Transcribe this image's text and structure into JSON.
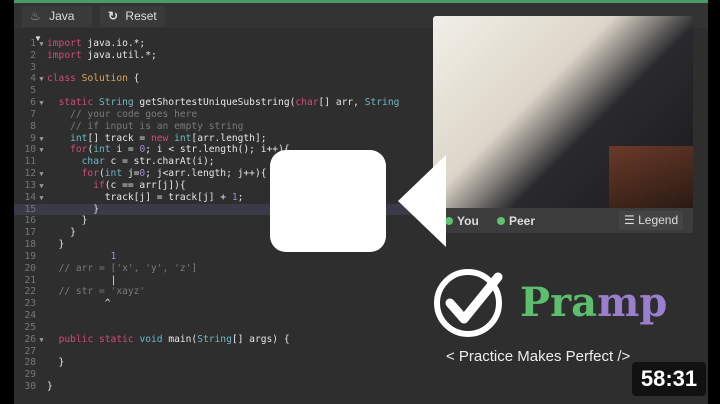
{
  "toolbar": {
    "language": "Java",
    "reset": "Reset"
  },
  "code": [
    {
      "n": "1",
      "f": true,
      "t": [
        [
          "import",
          "kw"
        ],
        " java.io.*;"
      ]
    },
    {
      "n": "2",
      "t": [
        [
          "import",
          "kw"
        ],
        " java.util.*;"
      ]
    },
    {
      "n": "3",
      "t": []
    },
    {
      "n": "4",
      "f": true,
      "t": [
        [
          "class",
          "kw"
        ],
        " ",
        [
          "Solution",
          "cl"
        ],
        " {"
      ]
    },
    {
      "n": "5",
      "t": []
    },
    {
      "n": "6",
      "f": true,
      "t": [
        "  ",
        [
          "static",
          "kw"
        ],
        " ",
        [
          "String",
          "ty"
        ],
        " getShortestUniqueSubstring(",
        [
          "char",
          "kw"
        ],
        "[] arr, ",
        [
          "String",
          "ty"
        ]
      ]
    },
    {
      "n": "7",
      "t": [
        "    ",
        [
          "// your code goes here",
          "cm"
        ]
      ]
    },
    {
      "n": "8",
      "t": [
        "    ",
        [
          "// if input is an empty string",
          "cm"
        ]
      ]
    },
    {
      "n": "9",
      "f": true,
      "t": [
        "    ",
        [
          "int",
          "ty"
        ],
        "[] track = ",
        [
          "new",
          "kw"
        ],
        " ",
        [
          "int",
          "ty"
        ],
        "[arr.length];"
      ]
    },
    {
      "n": "10",
      "f": true,
      "t": [
        "    ",
        [
          "for",
          "kw"
        ],
        "(",
        [
          "int",
          "ty"
        ],
        " i = ",
        [
          "0",
          "nu"
        ],
        "; i < str.length(); i++){"
      ]
    },
    {
      "n": "11",
      "t": [
        "      ",
        [
          "char",
          "ty"
        ],
        " c = str.charAt(i);"
      ]
    },
    {
      "n": "12",
      "f": true,
      "t": [
        "      ",
        [
          "for",
          "kw"
        ],
        "(",
        [
          "int",
          "ty"
        ],
        " j=",
        [
          "0",
          "nu"
        ],
        "; j<arr.length; j++){"
      ]
    },
    {
      "n": "13",
      "f": true,
      "t": [
        "        ",
        [
          "if",
          "kw"
        ],
        "(c == arr[j]){"
      ]
    },
    {
      "n": "14",
      "f": true,
      "t": [
        "          track[j] = track[j] + ",
        [
          "1",
          "nu"
        ],
        ";"
      ]
    },
    {
      "n": "15",
      "hl": true,
      "t": [
        "        }"
      ]
    },
    {
      "n": "16",
      "t": [
        "      }"
      ]
    },
    {
      "n": "17",
      "t": [
        "    }"
      ]
    },
    {
      "n": "18",
      "t": [
        "  }"
      ]
    },
    {
      "n": "19",
      "t": [
        "           ",
        [
          "1",
          "nu"
        ]
      ]
    },
    {
      "n": "20",
      "t": [
        "  ",
        [
          "// arr = ['x', 'y', 'z']",
          "cm"
        ]
      ]
    },
    {
      "n": "21",
      "t": [
        "           |"
      ]
    },
    {
      "n": "22",
      "t": [
        "  ",
        [
          "// str = 'xayz'",
          "cm"
        ]
      ]
    },
    {
      "n": "23",
      "t": [
        "          ^"
      ]
    },
    {
      "n": "24",
      "t": []
    },
    {
      "n": "25",
      "t": []
    },
    {
      "n": "26",
      "f": true,
      "t": [
        "  ",
        [
          "public",
          "kw"
        ],
        " ",
        [
          "static",
          "kw"
        ],
        " ",
        [
          "void",
          "ty"
        ],
        " main(",
        [
          "String",
          "ty"
        ],
        "[] args) {"
      ]
    },
    {
      "n": "27",
      "t": []
    },
    {
      "n": "28",
      "t": [
        "  }"
      ]
    },
    {
      "n": "29",
      "t": []
    },
    {
      "n": "30",
      "t": [
        "}"
      ]
    }
  ],
  "video": {
    "you": "You",
    "peer": "Peer",
    "legend": "Legend"
  },
  "brand": {
    "name_a": "Pra",
    "name_b": "mp",
    "tagline": "< Practice Makes Perfect />"
  },
  "duration": "58:31",
  "colors": {
    "green": "#5dbf6e",
    "purple": "#9b7fcf"
  }
}
